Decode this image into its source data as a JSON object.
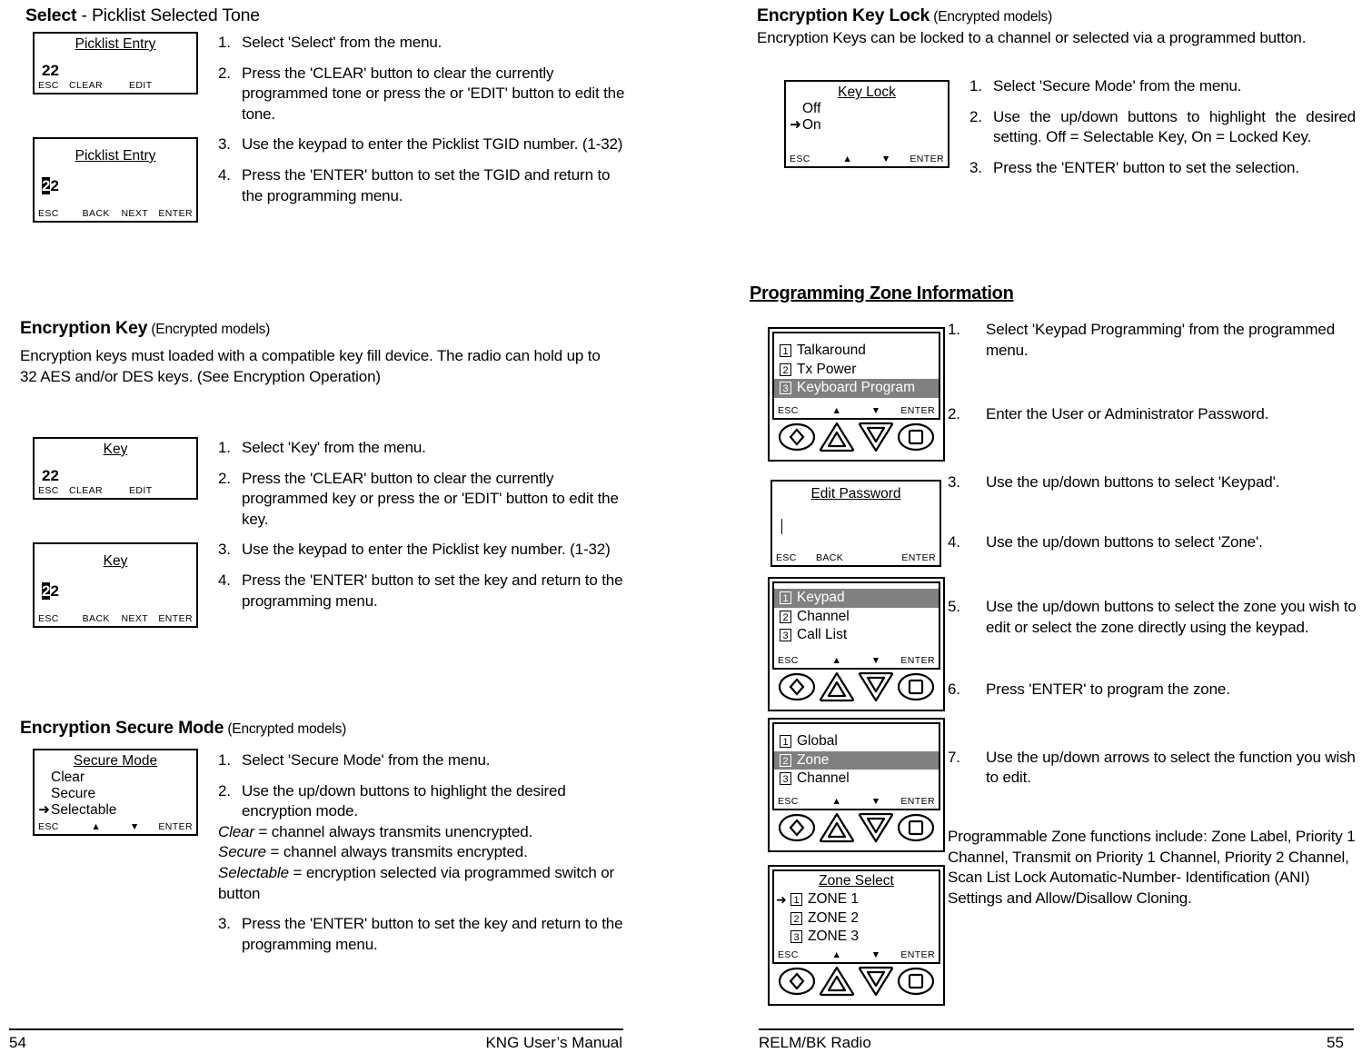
{
  "left_page": {
    "section1": {
      "heading_bold": "Select",
      "heading_rest": " - Picklist Selected Tone",
      "screen1": {
        "title": "Picklist Entry",
        "value": "22",
        "softkeys": [
          "ESC",
          "CLEAR",
          "EDIT"
        ]
      },
      "screen2": {
        "title": "Picklist Entry",
        "value_cursor": "2",
        "value_rest": "2",
        "softkeys": [
          "ESC",
          "BACK",
          "NEXT",
          "ENTER"
        ]
      },
      "steps": [
        {
          "num": "1.",
          "text": "Select 'Select' from the menu."
        },
        {
          "num": "2.",
          "text": "Press the 'CLEAR' button to clear the currently programmed tone or press the or 'EDIT' button to edit the tone."
        },
        {
          "num": "3.",
          "text": "Use the keypad to enter the Picklist TGID number. (1-32)"
        },
        {
          "num": "4.",
          "text": "Press the 'ENTER' button to set the TGID and return to the programming menu."
        }
      ]
    },
    "section2": {
      "heading_bold": "Encryption Key",
      "heading_light": " (Encrypted models)",
      "intro": "Encryption keys must loaded with a compatible key fill device. The radio can hold up to 32 AES and/or DES keys. (See Encryption Operation)",
      "screen1": {
        "title": "Key",
        "value": "22",
        "softkeys": [
          "ESC",
          "CLEAR",
          "EDIT"
        ]
      },
      "screen2": {
        "title": "Key",
        "value_cursor": "2",
        "value_rest": "2",
        "softkeys": [
          "ESC",
          "BACK",
          "NEXT",
          "ENTER"
        ]
      },
      "steps": [
        {
          "num": "1.",
          "text": "Select 'Key' from the menu."
        },
        {
          "num": "2.",
          "text": "Press the 'CLEAR' button to clear the currently programmed key or press the or 'EDIT' button to edit the key."
        },
        {
          "num": "3.",
          "text": "Use the keypad to enter the Picklist key number. (1-32)"
        },
        {
          "num": "4.",
          "text": "Press the 'ENTER' button to set the key and return to the programming menu."
        }
      ]
    },
    "section3": {
      "heading_bold": "Encryption Secure Mode",
      "heading_light": " (Encrypted models)",
      "screen": {
        "title": "Secure Mode",
        "items": [
          "Clear",
          "Secure",
          "Selectable"
        ],
        "selected_index": 2,
        "softkeys": [
          "ESC",
          "▲",
          "▼",
          "ENTER"
        ]
      },
      "steps": [
        {
          "num": "1.",
          "text": "Select 'Secure Mode' from the menu."
        },
        {
          "num": "2.",
          "text": "Use the up/down buttons to highlight the desired encryption mode."
        }
      ],
      "defs": [
        {
          "term": "Clear",
          "rest": " = channel always transmits unencrypted."
        },
        {
          "term": "Secure",
          "rest": " = channel always transmits encrypted."
        },
        {
          "term": "Selectable",
          "rest": " = encryption selected via programmed switch or button"
        }
      ],
      "step3": {
        "num": "3.",
        "text": "Press the 'ENTER' button to set the key and return to the programming menu."
      }
    },
    "footer": {
      "page_number": "54",
      "title": "KNG User’s Manual"
    }
  },
  "right_page": {
    "section1": {
      "heading_bold": "Encryption Key Lock",
      "heading_light": " (Encrypted models)",
      "intro": "Encryption Keys can be locked to a channel or selected via a programmed button.",
      "screen": {
        "title": "Key Lock",
        "items": [
          "Off",
          "On"
        ],
        "selected_index": 1,
        "softkeys": [
          "ESC",
          "▲",
          "▼",
          "ENTER"
        ]
      },
      "steps": [
        {
          "num": "1.",
          "text": "Select 'Secure Mode' from the menu."
        },
        {
          "num": "2.",
          "text": "Use the up/down buttons to highlight the desired setting. Off = Selectable Key, On = Locked Key."
        },
        {
          "num": "3.",
          "text": "Press the 'ENTER' button to set the selection."
        }
      ]
    },
    "section2": {
      "heading": "Programming Zone Information",
      "screens": [
        {
          "name": "keyboard-program-menu",
          "rows": [
            {
              "num": "1",
              "label": "Talkaround",
              "highlighted": false
            },
            {
              "num": "2",
              "label": "Tx Power",
              "highlighted": false
            },
            {
              "num": "3",
              "label": "Keyboard Program",
              "highlighted": true
            }
          ],
          "softkeys": [
            "ESC",
            "▲",
            "▼",
            "ENTER"
          ],
          "has_keypad": true
        },
        {
          "name": "edit-password",
          "title": "Edit Password",
          "value": "",
          "softkeys": [
            "ESC",
            "BACK",
            "",
            "ENTER"
          ],
          "has_keypad": false
        },
        {
          "name": "keypad-menu",
          "rows": [
            {
              "num": "1",
              "label": "Keypad",
              "highlighted": true
            },
            {
              "num": "2",
              "label": "Channel",
              "highlighted": false
            },
            {
              "num": "3",
              "label": "Call List",
              "highlighted": false
            }
          ],
          "softkeys": [
            "ESC",
            "▲",
            "▼",
            "ENTER"
          ],
          "has_keypad": true
        },
        {
          "name": "zone-menu",
          "rows": [
            {
              "num": "1",
              "label": "Global",
              "highlighted": false
            },
            {
              "num": "2",
              "label": "Zone",
              "highlighted": true
            },
            {
              "num": "3",
              "label": "Channel",
              "highlighted": false
            }
          ],
          "softkeys": [
            "ESC",
            "▲",
            "▼",
            "ENTER"
          ],
          "has_keypad": true
        },
        {
          "name": "zone-select",
          "title": "Zone Select",
          "rows": [
            {
              "num": "1",
              "label": "ZONE 1",
              "selected": true
            },
            {
              "num": "2",
              "label": "ZONE 2",
              "selected": false
            },
            {
              "num": "3",
              "label": "ZONE 3",
              "selected": false
            }
          ],
          "softkeys": [
            "ESC",
            "▲",
            "▼",
            "ENTER"
          ],
          "has_keypad": true
        }
      ],
      "steps": [
        {
          "num": "1.",
          "text": "Select 'Keypad Programming' from the programmed menu."
        },
        {
          "num": "2.",
          "text": "Enter the User or Administrator Password."
        },
        {
          "num": "3.",
          "text": "Use the up/down buttons to select 'Keypad'."
        },
        {
          "num": "4.",
          "text": "Use the up/down buttons to select  'Zone'."
        },
        {
          "num": "5.",
          "text": "Use the up/down buttons to select the zone you wish to edit or select the zone directly using the keypad."
        },
        {
          "num": "6.",
          "text": "Press 'ENTER' to program the zone."
        },
        {
          "num": "7.",
          "text": "Use the up/down arrows to select the function you wish to edit."
        }
      ],
      "closing": "Programmable Zone functions include: Zone Label, Priority 1 Channel, Transmit on Priority 1 Channel, Priority 2 Channel, Scan List Lock Automatic-Number- Identification (ANI) Settings and Allow/Disallow Cloning."
    },
    "footer": {
      "title": "RELM/BK Radio",
      "page_number": "55"
    }
  },
  "icons": {
    "arrow_marker": "➜",
    "up_triangle": "▲",
    "down_triangle": "▼"
  }
}
